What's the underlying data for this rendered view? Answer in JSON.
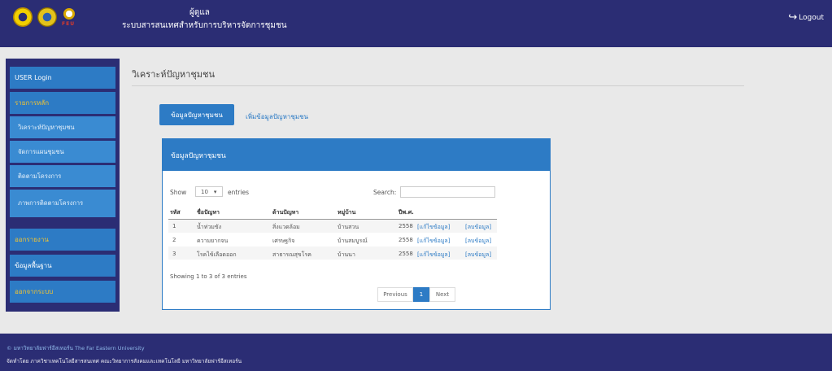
{
  "header": {
    "user": "ผู้ดูแล",
    "title": "ระบบสารสนเทศสำหรับการบริหารจัดการชุมชน",
    "logo3_text": "FEU",
    "logout": "Logout"
  },
  "sidebar": {
    "items": [
      {
        "label": "USER Login"
      },
      {
        "label": "รายการหลัก"
      },
      {
        "label": "วิเคราะห์ปัญหาชุมชน"
      },
      {
        "label": "จัดการแผนชุมชน"
      },
      {
        "label": "ติดตามโครงการ"
      },
      {
        "label": "ภาพการติดตามโครงการ"
      },
      {
        "label": "ออกรายงาน"
      },
      {
        "label": "ข้อมูลพื้นฐาน"
      },
      {
        "label": "ออกจากระบบ"
      }
    ]
  },
  "main": {
    "title": "วิเคราะห์ปัญหาชุมชน",
    "tabs": [
      {
        "label": "ข้อมูลปัญหาชุมชน"
      },
      {
        "label": "เพิ่มข้อมูลปัญหาชุมชน"
      }
    ],
    "panel": {
      "title": "ข้อมูลปัญหาชุมชน",
      "show_label": "Show",
      "entries_value": "10",
      "entries_label": "entries",
      "search_label": "Search:",
      "columns": [
        "รหัส",
        "ชื่อปัญหา",
        "ด้านปัญหา",
        "หมู่บ้าน",
        "ปีพ.ศ."
      ],
      "rows": [
        {
          "id": "1",
          "name": "น้ำท่วมขัง",
          "type": "สิ่งแวดล้อม",
          "village": "บ้านสวน",
          "year": "2558",
          "edit": "[แก้ไขข้อมูล]",
          "del": "[ลบข้อมูล]"
        },
        {
          "id": "2",
          "name": "ความยากจน",
          "type": "เศรษฐกิจ",
          "village": "บ้านสมบูรณ์",
          "year": "2558",
          "edit": "[แก้ไขข้อมูล]",
          "del": "[ลบข้อมูล]"
        },
        {
          "id": "3",
          "name": "โรคไข้เลือดออก",
          "type": "สาธารณสุขโรค",
          "village": "บ้านนา",
          "year": "2558",
          "edit": "[แก้ไขข้อมูล]",
          "del": "[ลบข้อมูล]"
        }
      ],
      "info": "Showing 1 to 3 of 3 entries",
      "pager": {
        "prev": "Previous",
        "current": "1",
        "next": "Next"
      }
    }
  },
  "footer": {
    "line1": "© มหาวิทยาลัยฟาร์อีสเทอร์น The Far Eastern University",
    "line2": "จัดทำโดย ภาควิชาเทคโนโลยีสารสนเทศ คณะวิทยาการสังคมและเทคโนโลยี มหาวิทยาลัยฟาร์อีสเทอร์น"
  }
}
